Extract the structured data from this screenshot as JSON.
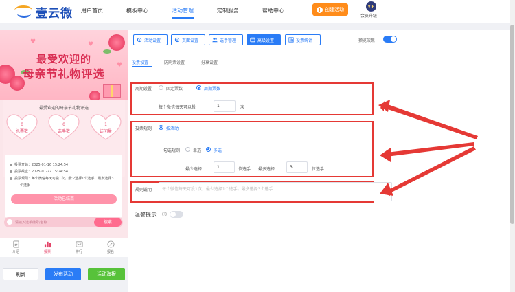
{
  "logo": {
    "text": "壹云微"
  },
  "nav": {
    "items": [
      {
        "label": "用户首页",
        "active": false
      },
      {
        "label": "模板中心",
        "active": false
      },
      {
        "label": "活动管理",
        "active": true
      },
      {
        "label": "定制服务",
        "active": false
      },
      {
        "label": "帮助中心",
        "active": false
      }
    ],
    "create_label": "创建活动",
    "vip_badge": "VIP",
    "vip_label": "会员升级"
  },
  "preview": {
    "title_line1": "最受欢迎的",
    "title_line2": "母亲节礼物评选",
    "card_title": "最受欢迎的母亲节礼物评选",
    "stats": [
      {
        "value": "0",
        "label": "总票数"
      },
      {
        "value": "0",
        "label": "选手数"
      },
      {
        "value": "1",
        "label": "访问量"
      }
    ],
    "info": {
      "start": "投票开始：2025-01-16 15:24:54",
      "end": "投票截止：2025-01-22 15:24:54",
      "rule": "投票规则：每个微信每天可投1次，最少选择1个选手，最多选择3",
      "rule_cont": "个选手",
      "end_button": "活动已结束"
    },
    "search_placeholder": "请输入选手编号/名称",
    "search_button": "搜索",
    "tabs": [
      {
        "label": "介绍",
        "icon": "doc-icon",
        "active": false
      },
      {
        "label": "投票",
        "icon": "bar-chart-icon",
        "active": true
      },
      {
        "label": "排行",
        "icon": "ranking-icon",
        "active": false
      },
      {
        "label": "报名",
        "icon": "edit-icon",
        "active": false
      }
    ],
    "footer": {
      "refresh": "刷新",
      "publish": "发布活动",
      "poster": "活动海报"
    }
  },
  "panel": {
    "toolbar": [
      {
        "label": "活动设置",
        "icon": "gear-icon",
        "active": false
      },
      {
        "label": "页面设置",
        "icon": "gear-icon",
        "active": false
      },
      {
        "label": "选手管理",
        "icon": "users-icon",
        "active": false
      },
      {
        "label": "高级设置",
        "icon": "window-icon",
        "active": true
      },
      {
        "label": "投票统计",
        "icon": "bar-chart-icon",
        "active": false
      }
    ],
    "preview_effect": "预览效果",
    "subtabs": [
      {
        "label": "投票设置",
        "active": true
      },
      {
        "label": "防刷票设置",
        "active": false
      },
      {
        "label": "分享设置",
        "active": false
      }
    ],
    "period": {
      "label": "周期设置",
      "option1": "固定票数",
      "option2": "周期票数",
      "per_prefix": "每个微信每天可以投",
      "per_value": "1",
      "per_suffix": "次"
    },
    "rule": {
      "label": "投票规则",
      "option": "按活动",
      "check_label": "勾选规则",
      "single": "单选",
      "multi": "多选",
      "min_label": "最少选择",
      "min_value": "1",
      "min_unit": "位选手",
      "max_label": "最多选择",
      "max_value": "3",
      "max_unit": "位选手"
    },
    "desc": {
      "label": "规则说明",
      "placeholder": "每个微信每天可投1次，最少选择1个选手，最多选择3个选手"
    },
    "hint": {
      "label": "温馨提示",
      "help": "?"
    }
  },
  "colors": {
    "primary": "#2a7cf6",
    "orange": "#ff8c1a",
    "green": "#57c23a",
    "red": "#e53935",
    "pink": "#ff6b8e"
  }
}
